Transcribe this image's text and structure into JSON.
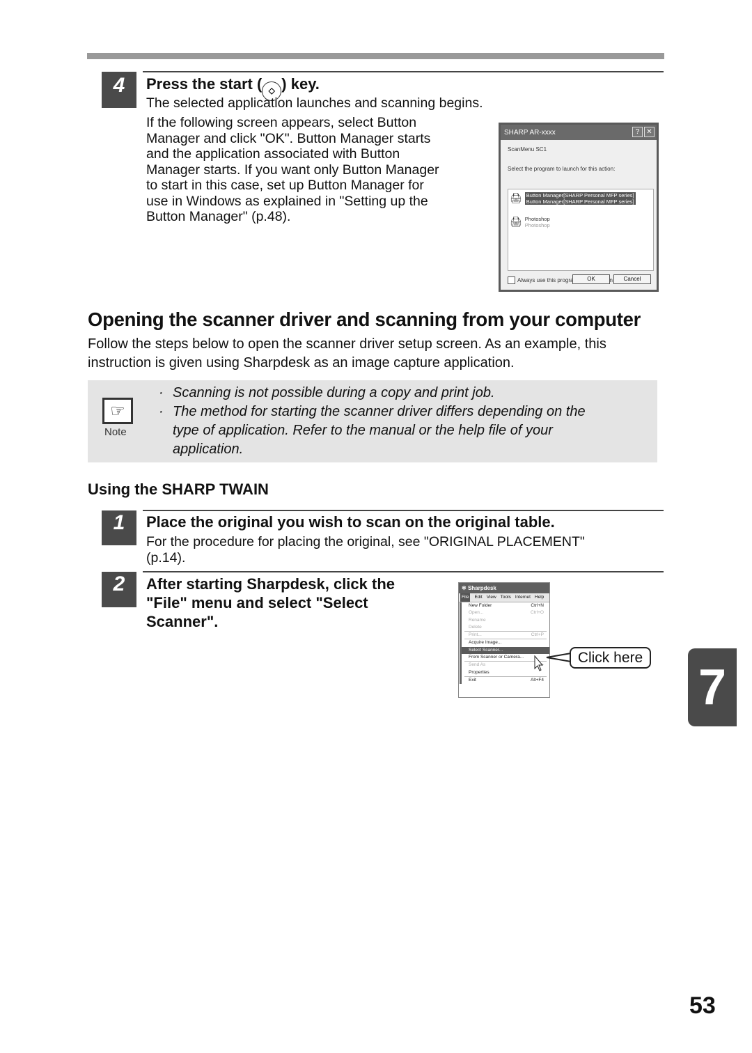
{
  "step4": {
    "number": "4",
    "title_prefix": "Press the start (",
    "title_suffix": ") key.",
    "start_key_icon": "start-key-icon",
    "line1": "The selected application launches and scanning begins.",
    "para": [
      "If the following screen appears, select Button",
      "Manager and click \"OK\". Button Manager starts",
      "and the application associated with Button",
      "Manager starts. If you want only Button Manager",
      "to start in this case, set up Button Manager for",
      "use in Windows as explained in \"Setting up the",
      "Button Manager\" (p.48)."
    ]
  },
  "dialog": {
    "title": "SHARP AR-xxxx",
    "help_button": "?",
    "close_button": "✕",
    "scanmenu": "ScanMenu SC1",
    "prompt": "Select the program to launch for this action:",
    "items": [
      {
        "line1": "Button Manager[SHARP Personal MFP series]",
        "line2": "Button Manager[SHARP Personal MFP series]",
        "selected": true
      },
      {
        "line1": "Photoshop",
        "line2": "Photoshop",
        "selected": false
      }
    ],
    "checkbox_label": "Always use this program for this action",
    "checkbox_checked": false,
    "ok": "OK",
    "cancel": "Cancel"
  },
  "section": {
    "heading": "Opening the scanner driver and scanning from your computer",
    "intro": [
      "Follow the steps below to open the scanner driver setup screen. As an example, this",
      "instruction is given using Sharpdesk as an image capture application."
    ]
  },
  "note": {
    "label": "Note",
    "icon": "pointing-hand-icon",
    "bullets": [
      [
        "Scanning is not possible during a copy and print job."
      ],
      [
        "The method for starting the scanner driver differs depending on the",
        "type of application. Refer to the manual or the help file of your",
        "application."
      ]
    ]
  },
  "subsection": {
    "heading": "Using the SHARP TWAIN"
  },
  "step1": {
    "number": "1",
    "title": "Place the original you wish to scan on the original table.",
    "body": [
      "For the procedure for placing the original, see \"ORIGINAL PLACEMENT\"",
      "(p.14)."
    ]
  },
  "step2": {
    "number": "2",
    "title": [
      "After starting Sharpdesk, click the",
      "\"File\" menu and select \"Select",
      "Scanner\"."
    ]
  },
  "sharpdesk": {
    "title": "Sharpdesk",
    "menubar": [
      "File",
      "Edit",
      "View",
      "Tools",
      "Internet",
      "Help"
    ],
    "items": [
      {
        "label": "New Folder",
        "shortcut": "Ctrl+N",
        "state": "normal"
      },
      {
        "label": "Open...",
        "shortcut": "Ctrl+O",
        "state": "disabled"
      },
      {
        "label": "Rename",
        "shortcut": "",
        "state": "disabled"
      },
      {
        "label": "Delete",
        "shortcut": "",
        "state": "disabled"
      },
      {
        "sep": true
      },
      {
        "label": "Print...",
        "shortcut": "Ctrl+P",
        "state": "disabled"
      },
      {
        "sep": true
      },
      {
        "label": "Acquire Image...",
        "shortcut": "",
        "state": "normal"
      },
      {
        "label": "Select Scanner...",
        "shortcut": "",
        "state": "highlighted"
      },
      {
        "label": "From Scanner or Camera...",
        "shortcut": "",
        "state": "normal"
      },
      {
        "sep": true
      },
      {
        "label": "Send As",
        "shortcut": "▸",
        "state": "disabled"
      },
      {
        "label": "Properties",
        "shortcut": "",
        "state": "normal"
      },
      {
        "sep": true
      },
      {
        "label": "Exit",
        "shortcut": "Alt+F4",
        "state": "normal"
      }
    ],
    "callout": "Click here"
  },
  "chapter_tab": "7",
  "page_number": "53"
}
